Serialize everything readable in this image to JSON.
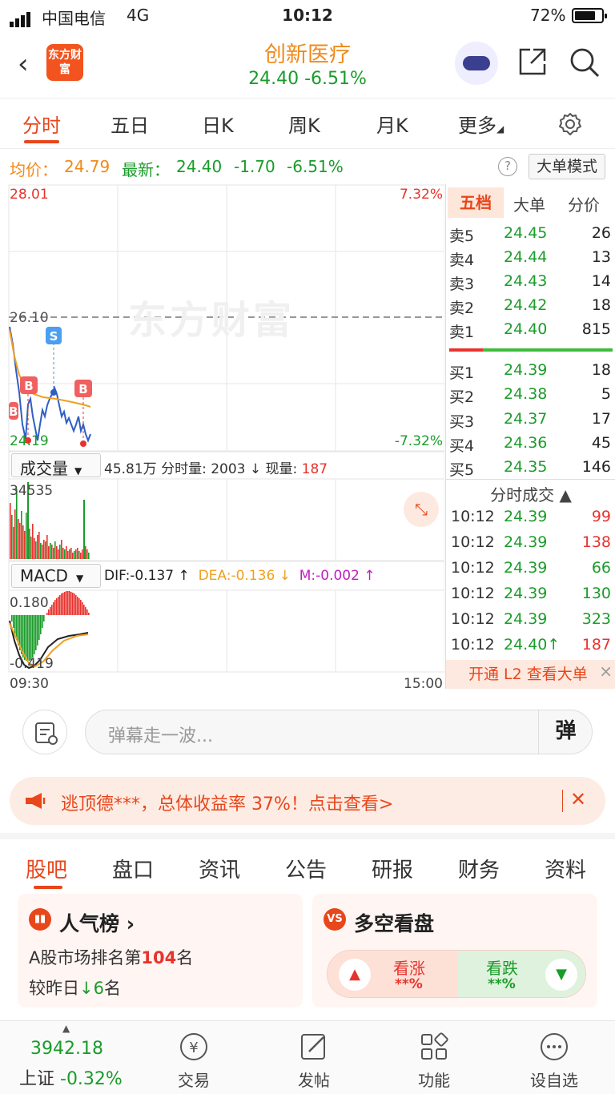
{
  "status": {
    "carrier": "中国电信",
    "network": "4G",
    "time": "10:12",
    "battery": "72%"
  },
  "header": {
    "logo": "东方财富",
    "stock_name": "创新医疗",
    "price_line": "24.40  -6.51%"
  },
  "chart_tabs": [
    "分时",
    "五日",
    "日K",
    "周K",
    "月K",
    "更多"
  ],
  "summary": {
    "avg_label": "均价：",
    "avg_value": "24.79",
    "last_label": "最新：",
    "last_value": "24.40",
    "change": "-1.70",
    "change_pct": "-6.51%",
    "help": "?",
    "mode_button": "大单模式"
  },
  "chart": {
    "watermark": "东方财富",
    "y_high": "28.01",
    "y_high_pct": "7.32%",
    "y_prev_close": "26.10",
    "y_low": "24.19",
    "y_low_pct": "-7.32%",
    "volume_label": "成交量",
    "volume_info": "45.81万 分时量: 2003 ↓ 现量:",
    "volume_now": "187",
    "volume_max": "34535",
    "macd_label": "MACD",
    "dif": "DIF:-0.137 ↑",
    "dea": "DEA:-0.136 ↓",
    "m": "M:-0.002 ↑",
    "macd_high": "0.180",
    "macd_low": "-0.419",
    "time_start": "09:30",
    "time_end": "15:00",
    "marker_b": "B",
    "marker_s": "S"
  },
  "book": {
    "tabs": [
      "五档",
      "大单",
      "分价"
    ],
    "asks": [
      {
        "label": "卖5",
        "price": "24.45",
        "vol": "26"
      },
      {
        "label": "卖4",
        "price": "24.44",
        "vol": "13"
      },
      {
        "label": "卖3",
        "price": "24.43",
        "vol": "14"
      },
      {
        "label": "卖2",
        "price": "24.42",
        "vol": "18"
      },
      {
        "label": "卖1",
        "price": "24.40",
        "vol": "815"
      }
    ],
    "bids": [
      {
        "label": "买1",
        "price": "24.39",
        "vol": "18"
      },
      {
        "label": "买2",
        "price": "24.38",
        "vol": "5"
      },
      {
        "label": "买3",
        "price": "24.37",
        "vol": "17"
      },
      {
        "label": "买4",
        "price": "24.36",
        "vol": "45"
      },
      {
        "label": "买5",
        "price": "24.35",
        "vol": "146"
      }
    ],
    "trades_title": "分时成交 ▲",
    "trades": [
      {
        "time": "10:12",
        "price": "24.39",
        "vol": "99"
      },
      {
        "time": "10:12",
        "price": "24.39",
        "vol": "138"
      },
      {
        "time": "10:12",
        "price": "24.39",
        "vol": "66"
      },
      {
        "time": "10:12",
        "price": "24.39",
        "vol": "130"
      },
      {
        "time": "10:12",
        "price": "24.39",
        "vol": "323"
      },
      {
        "time": "10:12",
        "price": "24.40↑",
        "vol": "187"
      }
    ],
    "l2_text": "开通 L2 查看大单"
  },
  "comment": {
    "placeholder": "弹幕走一波...",
    "dan_button": "弹"
  },
  "promo": {
    "text": "逃顶德***，总体收益率 37%！点击查看>"
  },
  "stock_tabs": [
    "股吧",
    "盘口",
    "资讯",
    "公告",
    "研报",
    "财务",
    "资料"
  ],
  "cards": {
    "popular": {
      "title": "人气榜 ›",
      "line1_pre": "A股市场排名第",
      "line1_num": "104",
      "line1_post": "名",
      "line2_pre": "较昨日",
      "line2_arrow": "↓",
      "line2_num": "6",
      "line2_post": "名"
    },
    "vote": {
      "title": "多空看盘",
      "up_label": "看涨",
      "up_value": "**%",
      "down_label": "看跌",
      "down_value": "**%"
    }
  },
  "nav": {
    "index_value": "3942.18",
    "index_label": "上证 -0.32%",
    "items": [
      "交易",
      "发帖",
      "功能",
      "设自选"
    ]
  }
}
